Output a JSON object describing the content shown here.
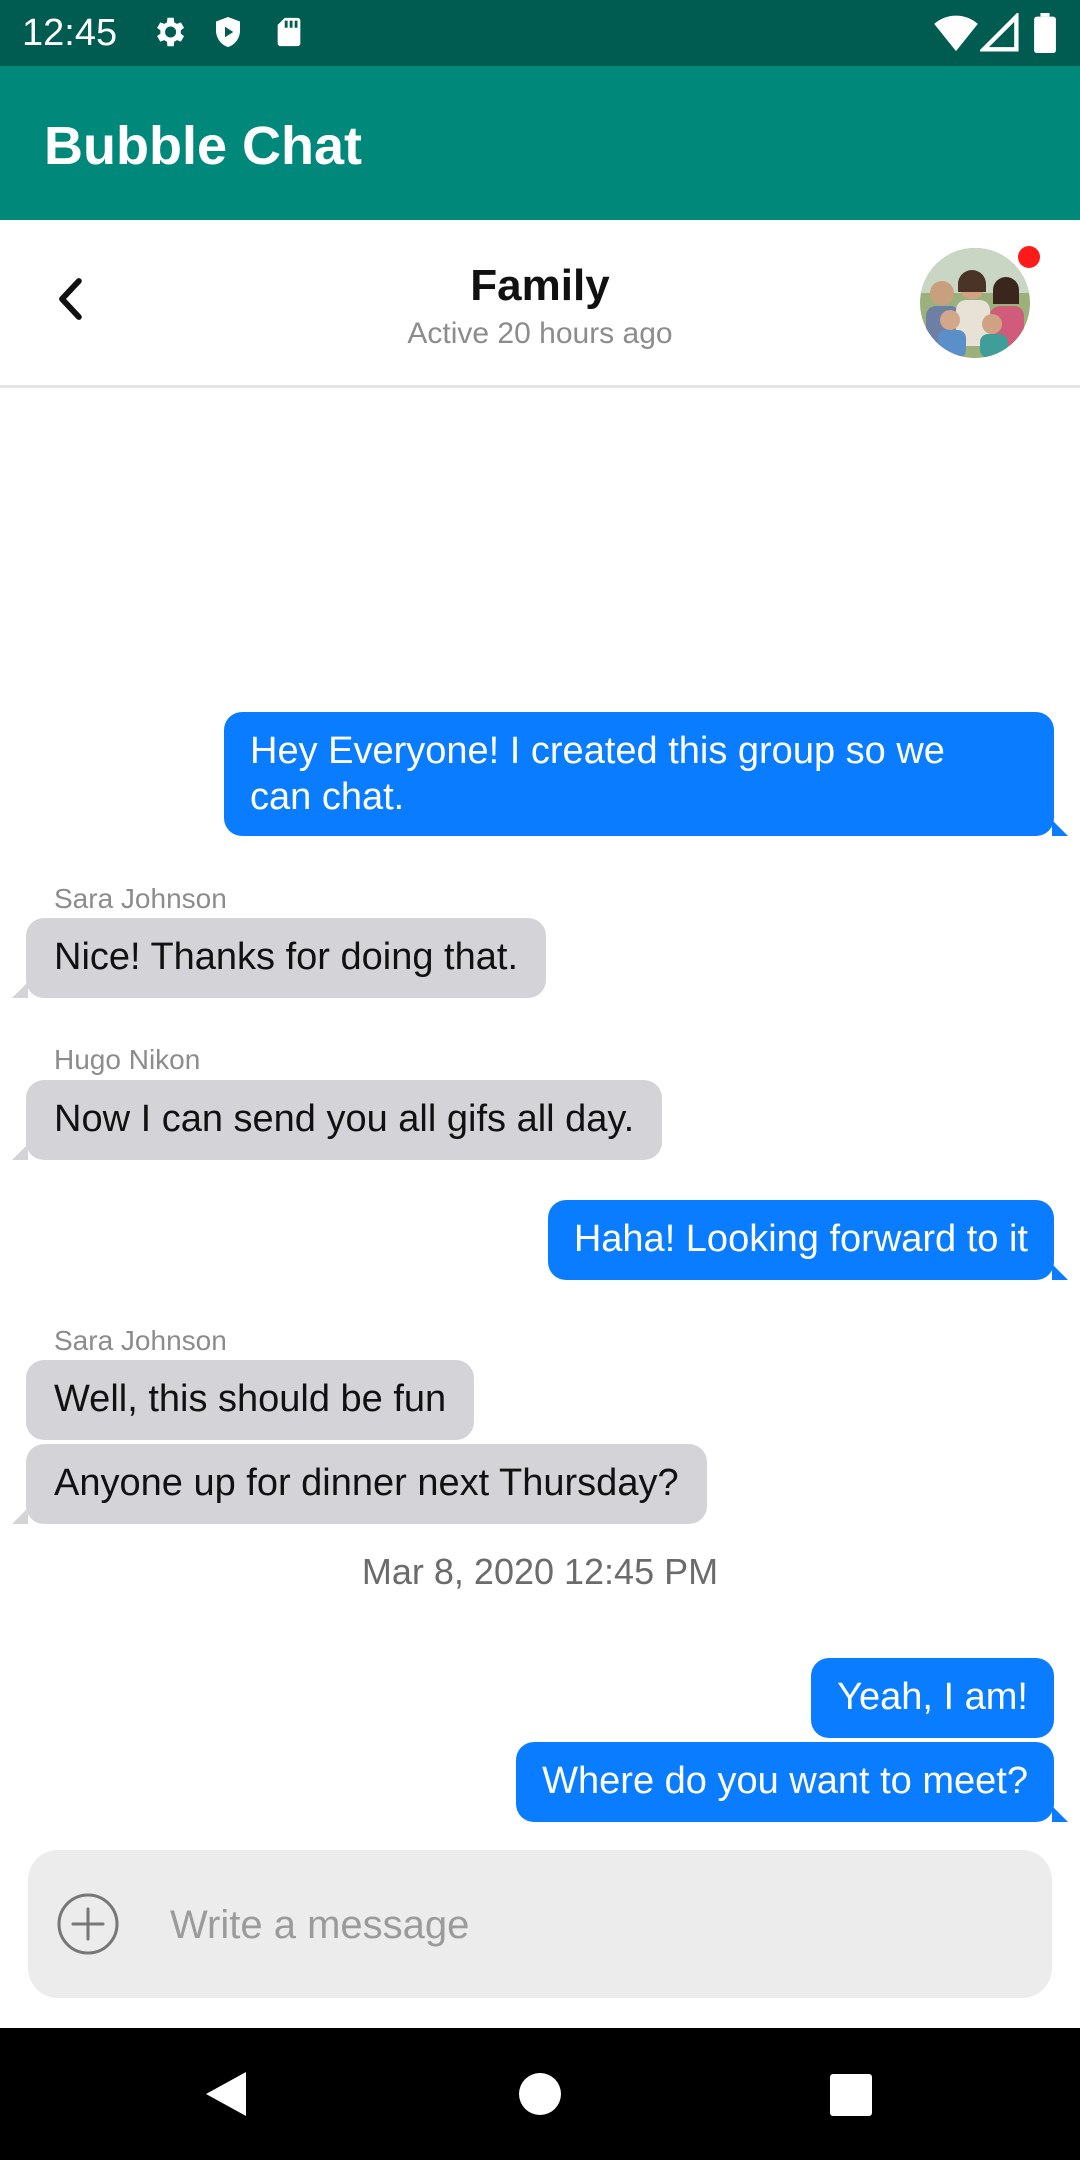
{
  "status_bar": {
    "time": "12:45",
    "left_icons": [
      "gear-icon",
      "shield-icon",
      "sd-card-icon"
    ],
    "right_icons": [
      "wifi-icon",
      "signal-icon",
      "battery-icon"
    ]
  },
  "app_bar": {
    "title": "Bubble Chat",
    "color": "#00897b"
  },
  "chat_header": {
    "title": "Family",
    "subtitle": "Active 20 hours ago",
    "back_icon": "chevron-left-icon",
    "avatar": "group-photo-avatar",
    "has_unread_indicator": true
  },
  "messages": [
    {
      "type": "message",
      "direction": "out",
      "lines": [
        "Hey Everyone! I created this group so we",
        "can chat."
      ]
    },
    {
      "type": "message",
      "direction": "in",
      "sender": "Sara Johnson",
      "text": "Nice! Thanks for doing that."
    },
    {
      "type": "message",
      "direction": "in",
      "sender": "Hugo Nikon",
      "text": "Now I can send you all gifs all day."
    },
    {
      "type": "message",
      "direction": "out",
      "text": "Haha! Looking forward to it"
    },
    {
      "type": "message",
      "direction": "in",
      "sender": "Sara Johnson",
      "text": "Well, this should be fun"
    },
    {
      "type": "message",
      "direction": "in",
      "text": "Anyone up for dinner next Thursday?"
    },
    {
      "type": "timestamp",
      "text": "Mar 8, 2020 12:45 PM"
    },
    {
      "type": "message",
      "direction": "out",
      "text": "Yeah, I am!"
    },
    {
      "type": "message",
      "direction": "out",
      "text": "Where do you want to meet?"
    }
  ],
  "composer": {
    "placeholder": "Write a message",
    "add_icon": "plus-circle-icon"
  },
  "nav_bar": {
    "buttons": [
      "back-triangle-icon",
      "home-circle-icon",
      "recents-square-icon"
    ]
  },
  "colors": {
    "outgoing_bubble": "#0a7cff",
    "incoming_bubble": "#d4d4d8",
    "status_bar": "#005c50"
  }
}
